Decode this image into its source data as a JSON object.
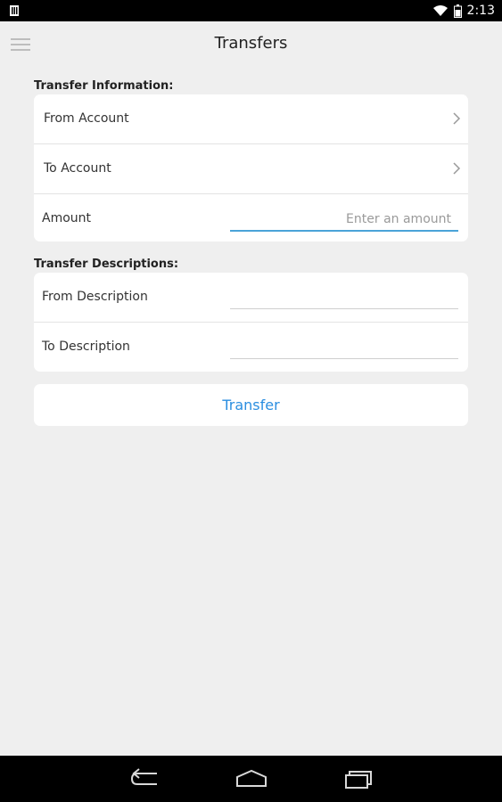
{
  "status_bar": {
    "time": "2:13",
    "icons": [
      "sim-card-icon",
      "wifi-icon",
      "battery-icon"
    ]
  },
  "header": {
    "title": "Transfers",
    "menu_icon": "hamburger-menu-icon"
  },
  "transfer_information": {
    "label": "Transfer Information:",
    "from_account": "From Account",
    "to_account": "To Account",
    "amount_label": "Amount",
    "amount_placeholder": "Enter an amount",
    "amount_value": ""
  },
  "transfer_descriptions": {
    "label": "Transfer Descriptions:",
    "from_description": "From Description",
    "from_description_value": "",
    "to_description": "To Description",
    "to_description_value": ""
  },
  "actions": {
    "transfer_label": "Transfer"
  },
  "colors": {
    "background": "#efefef",
    "accent": "#2a8ee0",
    "active_underline": "#4aa3d8"
  },
  "nav_bar": {
    "icons": [
      "back-icon",
      "home-icon",
      "recent-apps-icon"
    ]
  }
}
